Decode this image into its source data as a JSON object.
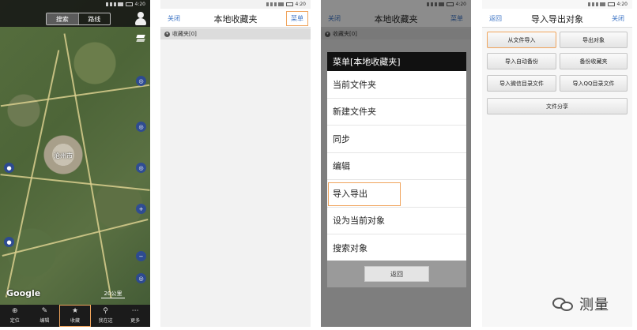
{
  "status": {
    "time": "4:20"
  },
  "map_screen": {
    "tabs": [
      "搜索",
      "路线"
    ],
    "city_label": "沧州市",
    "scale_label": "20公里",
    "logo": "Google",
    "bottom_nav": [
      {
        "label": "定位",
        "icon": "locate-icon",
        "glyph": "⊕"
      },
      {
        "label": "编辑",
        "icon": "pencil-icon",
        "glyph": "✎"
      },
      {
        "label": "收藏",
        "icon": "star-icon",
        "glyph": "★"
      },
      {
        "label": "我在这",
        "icon": "pin-icon",
        "glyph": "⚲"
      },
      {
        "label": "更多",
        "icon": "more-icon",
        "glyph": "⋯"
      }
    ]
  },
  "favorites_screen": {
    "close_label": "关闭",
    "title": "本地收藏夹",
    "menu_label": "菜单",
    "folder_label": "收藏夹[0]"
  },
  "menu_screen": {
    "close_label": "关闭",
    "title": "本地收藏夹",
    "menu_label": "菜单",
    "folder_label": "收藏夹[0]",
    "menu_title": "菜单[本地收藏夹]",
    "items": [
      "当前文件夹",
      "新建文件夹",
      "同步",
      "编辑",
      "导入导出",
      "设为当前对象",
      "搜索对象"
    ],
    "back_label": "返回"
  },
  "import_export_screen": {
    "back_label": "返回",
    "title": "导入导出对象",
    "close_label": "关闭",
    "buttons": {
      "import_file": "从文件导入",
      "export_object": "导出对象",
      "import_auto_backup": "导入自动备份",
      "backup_favorites": "备份收藏夹",
      "import_wechat_dir": "导入微信目录文件",
      "import_qq_dir": "导入QQ目录文件",
      "share_file": "文件分享"
    }
  },
  "watermark": {
    "text": "测量"
  },
  "colors": {
    "link": "#3a72c4",
    "highlight": "#f0a45c"
  }
}
